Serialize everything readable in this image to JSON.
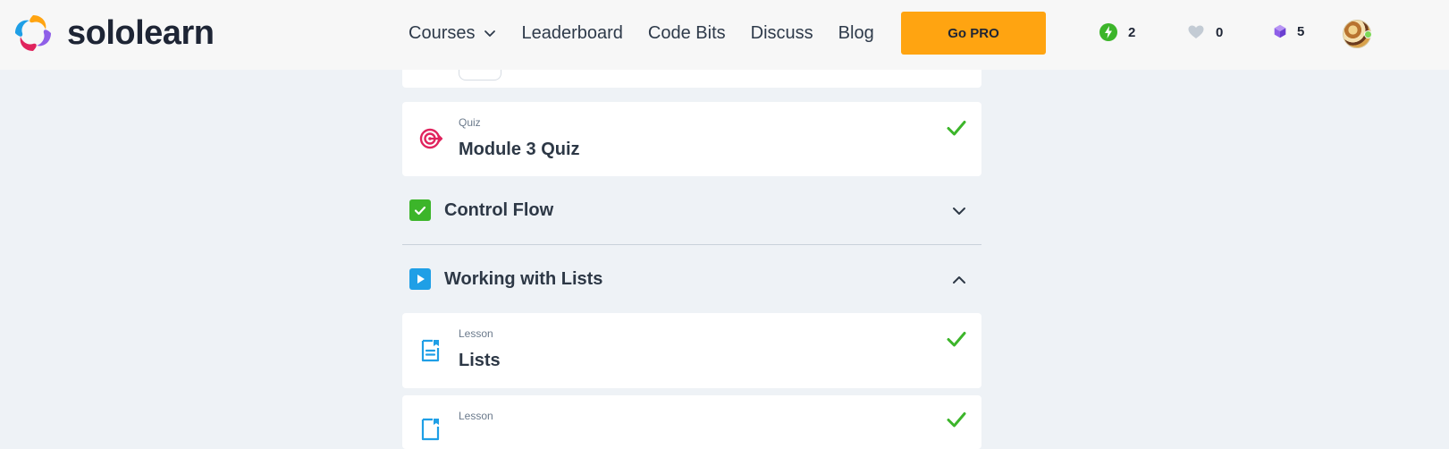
{
  "brand": {
    "name": "sololearn",
    "logo_icon": "sololearn-logo-icon"
  },
  "nav": {
    "items": [
      {
        "label": "Courses",
        "has_dropdown": true
      },
      {
        "label": "Leaderboard"
      },
      {
        "label": "Code Bits"
      },
      {
        "label": "Discuss"
      },
      {
        "label": "Blog"
      }
    ],
    "go_pro_label": "Go PRO"
  },
  "stats": {
    "streak": {
      "icon": "lightning-icon",
      "value": "2",
      "color": "#3cb52a"
    },
    "hearts": {
      "icon": "heart-icon",
      "value": "0",
      "color": "#c3cbd4"
    },
    "bits": {
      "icon": "cube-icon",
      "value": "5",
      "color": "#8f5fe8"
    }
  },
  "course": {
    "quiz_item": {
      "kind": "Quiz",
      "title": "Module 3 Quiz",
      "completed": true,
      "icon": "target-icon"
    },
    "sections": [
      {
        "title": "Control Flow",
        "status": "completed",
        "expanded": false
      },
      {
        "title": "Working with Lists",
        "status": "in-progress",
        "expanded": true
      }
    ],
    "lessons": [
      {
        "kind": "Lesson",
        "title": "Lists",
        "completed": true,
        "icon": "document-icon"
      },
      {
        "kind": "Lesson",
        "title": "",
        "completed": true,
        "icon": "document-icon"
      }
    ]
  },
  "colors": {
    "accent_orange": "#ffa411",
    "check_green": "#3cb52a",
    "quiz_pink": "#e0245e",
    "lesson_blue": "#1f9fe6",
    "background": "#eef2f6"
  }
}
